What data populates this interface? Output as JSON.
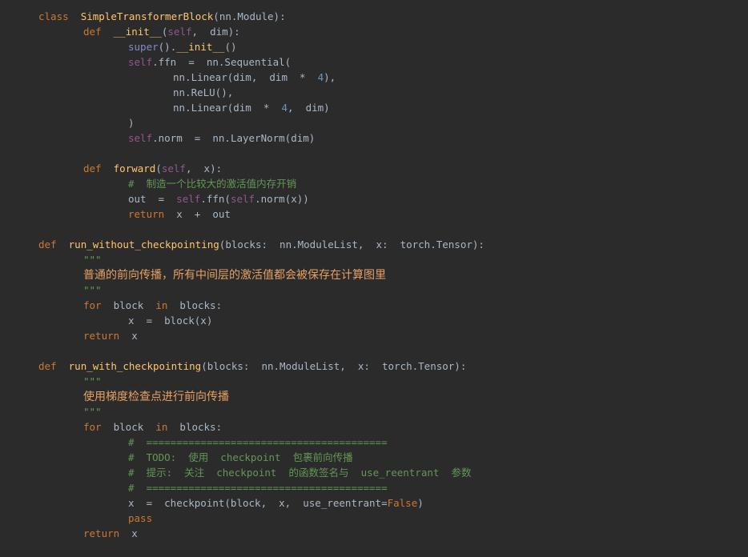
{
  "editor": {
    "lines": [
      {
        "indent": 0,
        "tokens": [
          {
            "t": "class",
            "c": "kw"
          },
          {
            "t": "  ",
            "c": "op"
          },
          {
            "t": "SimpleTransformerBlock",
            "c": "fn"
          },
          {
            "t": "(",
            "c": "op"
          },
          {
            "t": "nn.Module",
            "c": "name"
          },
          {
            "t": "):",
            "c": "op"
          }
        ]
      },
      {
        "indent": 1,
        "tokens": [
          {
            "t": "def",
            "c": "kw"
          },
          {
            "t": "  ",
            "c": "op"
          },
          {
            "t": "__init__",
            "c": "fn"
          },
          {
            "t": "(",
            "c": "op"
          },
          {
            "t": "self",
            "c": "self"
          },
          {
            "t": ",  ",
            "c": "op"
          },
          {
            "t": "dim",
            "c": "name"
          },
          {
            "t": "):",
            "c": "op"
          }
        ]
      },
      {
        "indent": 2,
        "tokens": [
          {
            "t": "super",
            "c": "builtin"
          },
          {
            "t": "().",
            "c": "op"
          },
          {
            "t": "__init__",
            "c": "fn"
          },
          {
            "t": "()",
            "c": "op"
          }
        ]
      },
      {
        "indent": 2,
        "tokens": [
          {
            "t": "self",
            "c": "self"
          },
          {
            "t": ".ffn  =  nn.Sequential(",
            "c": "op"
          }
        ]
      },
      {
        "indent": 3,
        "tokens": [
          {
            "t": "nn.Linear(dim,  dim  *  ",
            "c": "op"
          },
          {
            "t": "4",
            "c": "num"
          },
          {
            "t": "),",
            "c": "op"
          }
        ]
      },
      {
        "indent": 3,
        "tokens": [
          {
            "t": "nn.ReLU(),",
            "c": "op"
          }
        ]
      },
      {
        "indent": 3,
        "tokens": [
          {
            "t": "nn.Linear(dim  *  ",
            "c": "op"
          },
          {
            "t": "4",
            "c": "num"
          },
          {
            "t": ",  dim)",
            "c": "op"
          }
        ]
      },
      {
        "indent": 2,
        "tokens": [
          {
            "t": ")",
            "c": "op"
          }
        ]
      },
      {
        "indent": 2,
        "tokens": [
          {
            "t": "self",
            "c": "self"
          },
          {
            "t": ".norm  =  nn.LayerNorm(dim)",
            "c": "op"
          }
        ]
      },
      {
        "indent": 0,
        "tokens": []
      },
      {
        "indent": 1,
        "tokens": [
          {
            "t": "def",
            "c": "kw"
          },
          {
            "t": "  ",
            "c": "op"
          },
          {
            "t": "forward",
            "c": "fn"
          },
          {
            "t": "(",
            "c": "op"
          },
          {
            "t": "self",
            "c": "self"
          },
          {
            "t": ",  x):",
            "c": "op"
          }
        ]
      },
      {
        "indent": 2,
        "tokens": [
          {
            "t": "#  ",
            "c": "comment"
          },
          {
            "t": "制造一个比较大的激活值内存开销",
            "c": "comment"
          }
        ]
      },
      {
        "indent": 2,
        "tokens": [
          {
            "t": "out  =  ",
            "c": "op"
          },
          {
            "t": "self",
            "c": "self"
          },
          {
            "t": ".ffn(",
            "c": "op"
          },
          {
            "t": "self",
            "c": "self"
          },
          {
            "t": ".norm(x))",
            "c": "op"
          }
        ]
      },
      {
        "indent": 2,
        "tokens": [
          {
            "t": "return",
            "c": "kw"
          },
          {
            "t": "  x  +  out",
            "c": "op"
          }
        ]
      },
      {
        "indent": 0,
        "tokens": []
      },
      {
        "indent": 0,
        "tokens": [
          {
            "t": "def",
            "c": "kw"
          },
          {
            "t": "  ",
            "c": "op"
          },
          {
            "t": "run_without_checkpointing",
            "c": "fn"
          },
          {
            "t": "(blocks:  nn.ModuleList,  x:  torch.Tensor):",
            "c": "op"
          }
        ]
      },
      {
        "indent": 1,
        "tokens": [
          {
            "t": "\"\"\"",
            "c": "doc"
          }
        ]
      },
      {
        "indent": 1,
        "tokens": [
          {
            "t": "普通的前向传播，所有中间层的激活值都会被保存在计算图里",
            "c": "cn"
          }
        ]
      },
      {
        "indent": 1,
        "tokens": [
          {
            "t": "\"\"\"",
            "c": "doc"
          }
        ]
      },
      {
        "indent": 1,
        "tokens": [
          {
            "t": "for",
            "c": "kw"
          },
          {
            "t": "  block  ",
            "c": "op"
          },
          {
            "t": "in",
            "c": "kw"
          },
          {
            "t": "  blocks:",
            "c": "op"
          }
        ]
      },
      {
        "indent": 2,
        "tokens": [
          {
            "t": "x  =  block(x)",
            "c": "op"
          }
        ]
      },
      {
        "indent": 1,
        "tokens": [
          {
            "t": "return",
            "c": "kw"
          },
          {
            "t": "  x",
            "c": "op"
          }
        ]
      },
      {
        "indent": 0,
        "tokens": []
      },
      {
        "indent": 0,
        "tokens": [
          {
            "t": "def",
            "c": "kw"
          },
          {
            "t": "  ",
            "c": "op"
          },
          {
            "t": "run_with_checkpointing",
            "c": "fn"
          },
          {
            "t": "(blocks:  nn.ModuleList,  x:  torch.Tensor):",
            "c": "op"
          }
        ]
      },
      {
        "indent": 1,
        "tokens": [
          {
            "t": "\"\"\"",
            "c": "doc"
          }
        ]
      },
      {
        "indent": 1,
        "tokens": [
          {
            "t": "使用梯度检查点进行前向传播",
            "c": "cn"
          }
        ]
      },
      {
        "indent": 1,
        "tokens": [
          {
            "t": "\"\"\"",
            "c": "doc"
          }
        ]
      },
      {
        "indent": 1,
        "tokens": [
          {
            "t": "for",
            "c": "kw"
          },
          {
            "t": "  block  ",
            "c": "op"
          },
          {
            "t": "in",
            "c": "kw"
          },
          {
            "t": "  blocks:",
            "c": "op"
          }
        ]
      },
      {
        "indent": 2,
        "tokens": [
          {
            "t": "#  ========================================",
            "c": "comment"
          }
        ]
      },
      {
        "indent": 2,
        "tokens": [
          {
            "t": "#  TODO:  使用  checkpoint  包裹前向传播",
            "c": "comment"
          }
        ]
      },
      {
        "indent": 2,
        "tokens": [
          {
            "t": "#  提示:  关注  checkpoint  的函数签名与  use_reentrant  参数",
            "c": "comment"
          }
        ]
      },
      {
        "indent": 2,
        "tokens": [
          {
            "t": "#  ========================================",
            "c": "comment"
          }
        ]
      },
      {
        "indent": 2,
        "tokens": [
          {
            "t": "x  =  checkpoint(block,  x,  use_reentrant=",
            "c": "op"
          },
          {
            "t": "False",
            "c": "kw"
          },
          {
            "t": ")",
            "c": "op"
          }
        ]
      },
      {
        "indent": 2,
        "tokens": [
          {
            "t": "pass",
            "c": "kw"
          }
        ]
      },
      {
        "indent": 1,
        "tokens": [
          {
            "t": "return",
            "c": "kw"
          },
          {
            "t": "  x",
            "c": "op"
          }
        ]
      }
    ],
    "colors": {
      "background": "#2b2b2b",
      "keyword": "#cc7832",
      "function": "#ffc66d",
      "default": "#a9b7c6",
      "comment": "#629755",
      "number": "#6897bb",
      "self": "#94558d"
    }
  }
}
